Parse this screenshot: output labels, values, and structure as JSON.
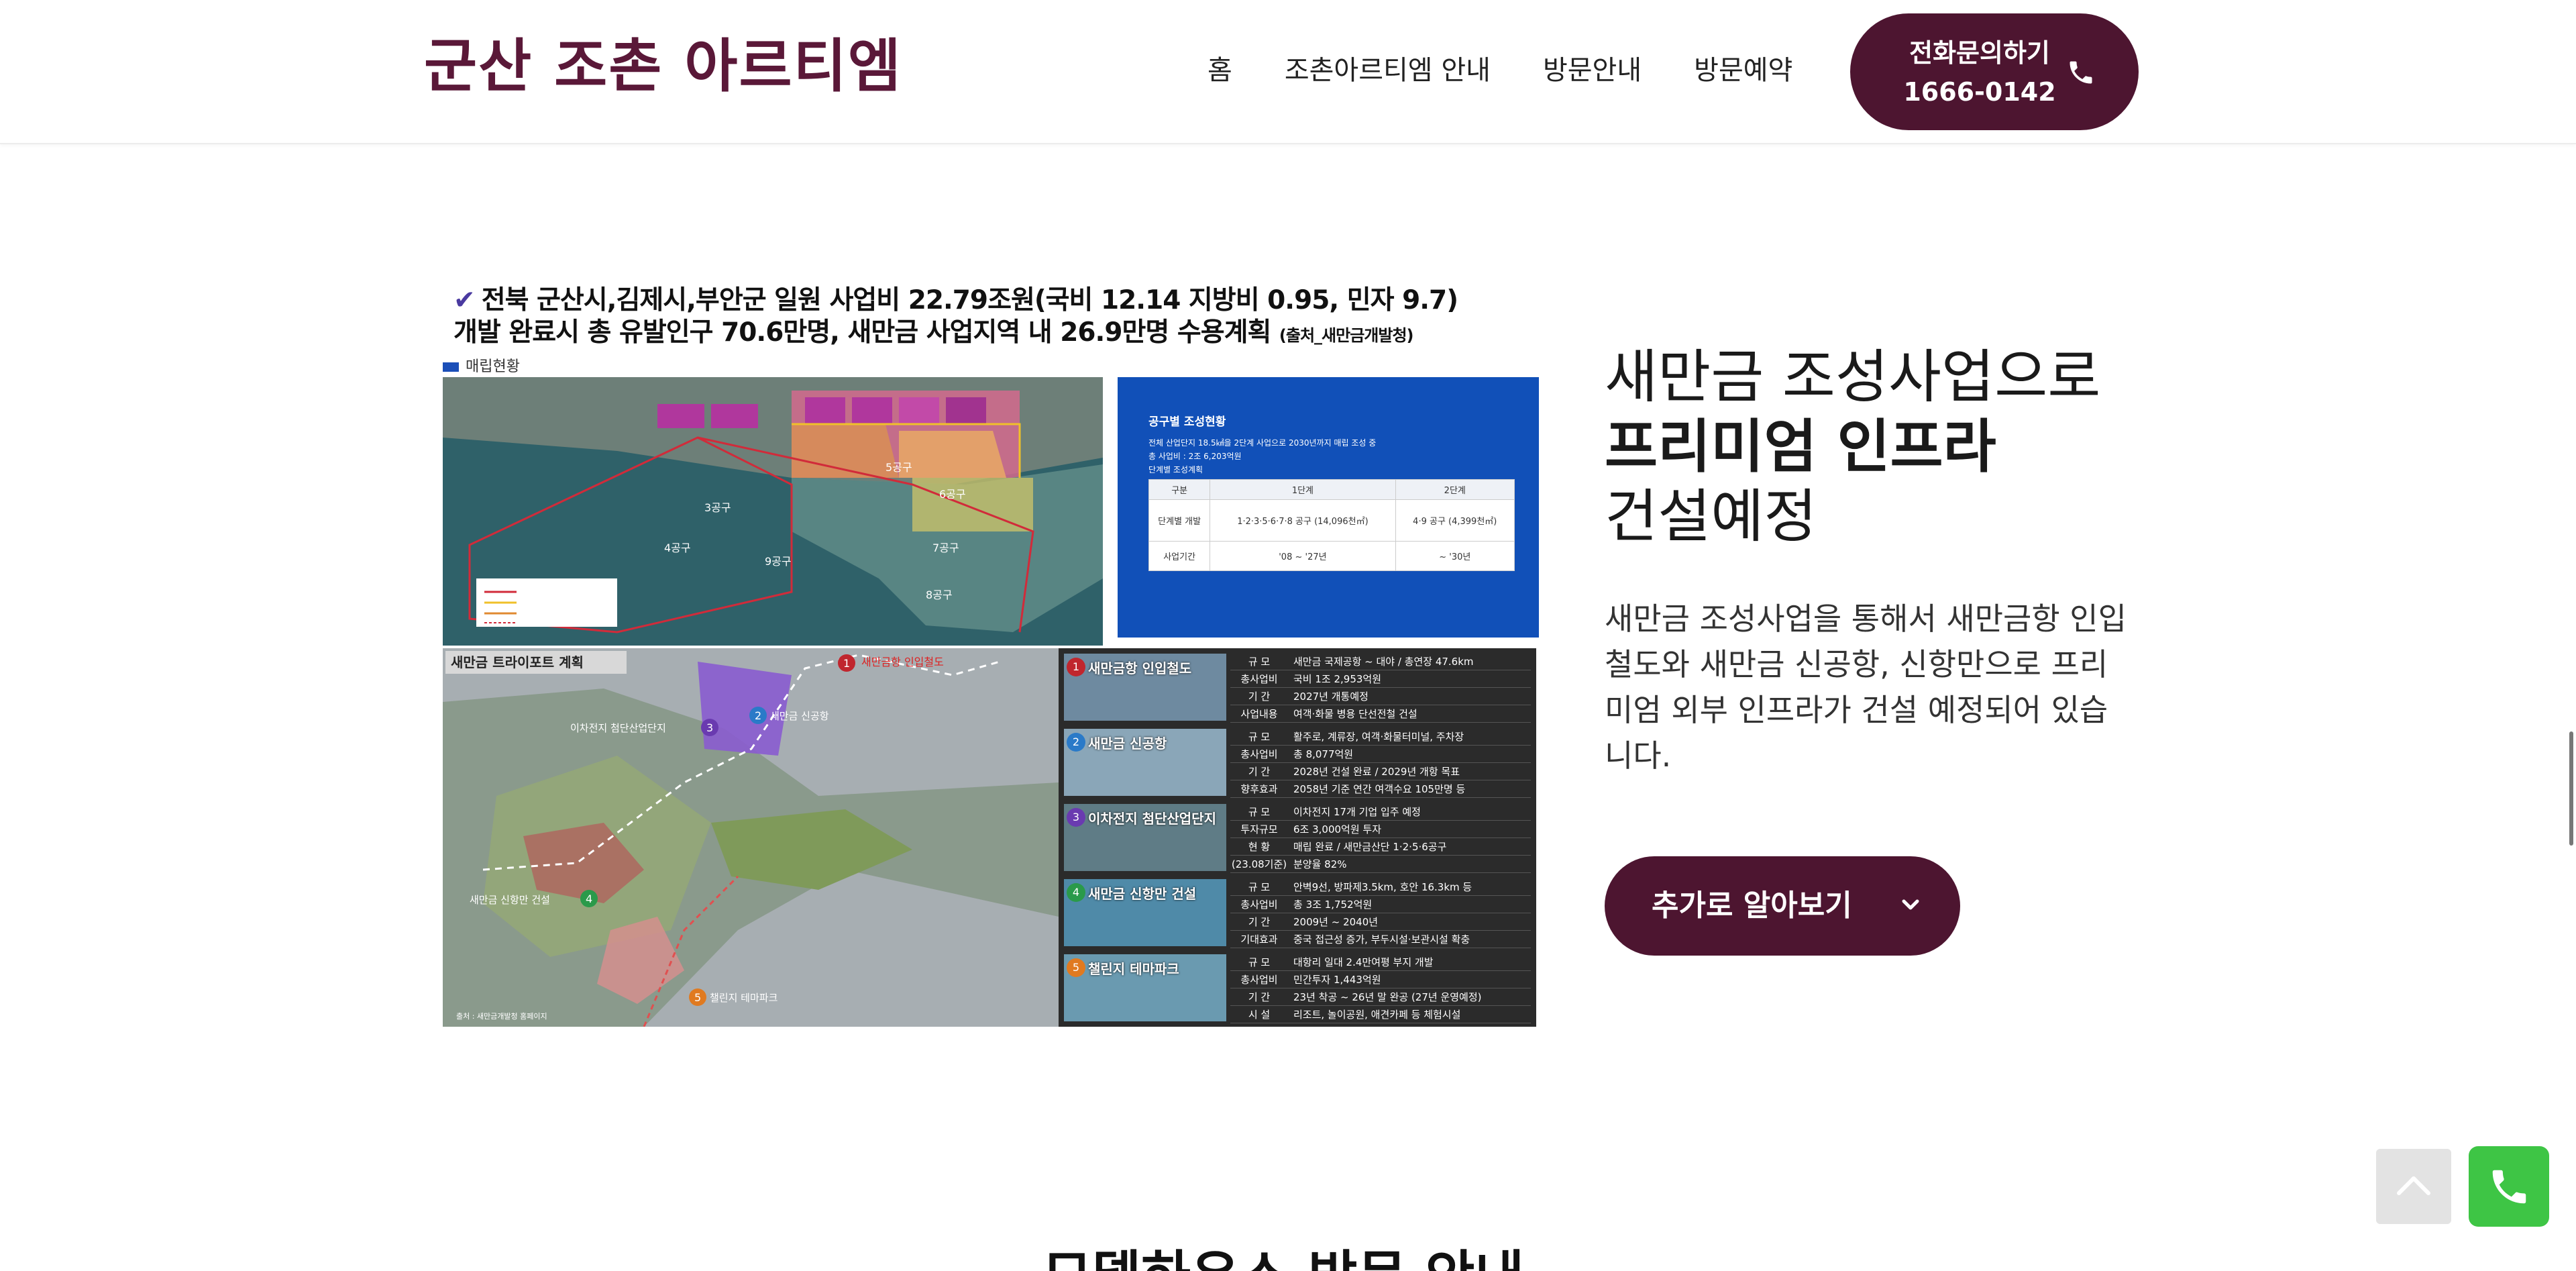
{
  "header": {
    "logo": "군산 조촌 아르티엠",
    "nav": [
      "홈",
      "조촌아르티엠 안내",
      "방문안내",
      "방문예약"
    ],
    "call": {
      "line1": "전화문의하기",
      "line2": "1666-0142",
      "icon": "phone-icon"
    }
  },
  "infographic": {
    "line1": "전북 군산시,김제시,부안군 일원  사업비 22.79조원(국비 12.14 지방비 0.95, 민자 9.7)",
    "line2": "개발 완료시 총 유발인구 70.6만명, 새만금 사업지역 내 26.9만명 수용계획",
    "line2_source": "(출처_새만금개발청)",
    "tag": "매립현황",
    "map1_labels": [
      "3공구",
      "4공구",
      "5공구",
      "6공구",
      "7공구",
      "8공구",
      "9공구"
    ],
    "blue": {
      "title": "공구별 조성현황",
      "bullets": [
        "전체 산업단지 18.5㎢을 2단계 사업으로 2030년까지 매립 조성 중",
        "총 사업비 : 2조 6,203억원",
        "단계별 조성계획"
      ],
      "table_head": [
        "구분",
        "1단계",
        "2단계"
      ],
      "row1": [
        "단계별 개발",
        "1·2·3·5·6·7·8 공구 (14,096천㎡)",
        "4·9 공구 (4,399천㎡)"
      ],
      "row2": [
        "사업기간",
        "'08 ~ '27년",
        "~ '30년"
      ]
    },
    "map2_title": "새만금 트라이포트 계획",
    "map2_labels": [
      "새만금항 인입철도",
      "새만금 신공항",
      "이차전지 첨단산업단지",
      "새만금 신항만 건설",
      "챌린지 테마파크"
    ],
    "map2_source": "출처 : 새만금개발청 홈페이지",
    "items": [
      {
        "num": "1",
        "title": "새만금항 인입철도",
        "rows": [
          [
            "규   모",
            "새만금 국제공항 ~ 대야 / 총연장 47.6km"
          ],
          [
            "총사업비",
            "국비 1조 2,953억원"
          ],
          [
            "기   간",
            "2027년 개통예정"
          ],
          [
            "사업내용",
            "여객·화물 병용 단선전철 건설"
          ]
        ]
      },
      {
        "num": "2",
        "title": "새만금 신공항",
        "rows": [
          [
            "규   모",
            "활주로, 계류장, 여객·화물터미널, 주차장"
          ],
          [
            "총사업비",
            "총 8,077억원"
          ],
          [
            "기   간",
            "2028년 건설 완료 / 2029년 개항 목표"
          ],
          [
            "향후효과",
            "2058년 기준 연간 여객수요 105만명 등"
          ]
        ]
      },
      {
        "num": "3",
        "title": "이차전지 첨단산업단지",
        "rows": [
          [
            "규   모",
            "이차전지 17개 기업 입주 예정"
          ],
          [
            "투자규모",
            "6조 3,000억원 투자"
          ],
          [
            "현   황",
            "매립 완료 / 새만금산단 1·2·5·6공구"
          ],
          [
            "(23.08기준)",
            "분양율 82%"
          ]
        ]
      },
      {
        "num": "4",
        "title": "새만금 신항만 건설",
        "rows": [
          [
            "규   모",
            "안벽9선, 방파제3.5km, 호안 16.3km 등"
          ],
          [
            "총사업비",
            "총 3조 1,752억원"
          ],
          [
            "기   간",
            "2009년 ~ 2040년"
          ],
          [
            "기대효과",
            "중국 접근성 증가, 부두시설·보관시설 확충"
          ]
        ]
      },
      {
        "num": "5",
        "title": "챌린지 테마파크",
        "rows": [
          [
            "규   모",
            "대항리 일대 2.4만여평 부지 개발"
          ],
          [
            "총사업비",
            "민간투자 1,443억원"
          ],
          [
            "기   간",
            "23년 착공 ~ 26년 말 완공 (27년 운영예정)"
          ],
          [
            "시   설",
            "리조트, 놀이공원, 애견카페 등 체험시설"
          ]
        ]
      }
    ]
  },
  "section": {
    "heading_line1": "새만금 조성사업으로",
    "heading_line2": "프리미엄 인프라",
    "heading_line3": "건설예정",
    "description": "새만금 조성사업을 통해서 새만금항 인입철도와 새만금 신공항, 신항만으로 프리미엄 외부 인프라가 건설 예정되어 있습니다.",
    "button": "추가로 알아보기"
  },
  "next_section_heading": "모델하우스 방문 안내",
  "colors": {
    "brand": "#4d1530",
    "fab_green": "#3ec545",
    "blue_panel": "#1150b8"
  }
}
